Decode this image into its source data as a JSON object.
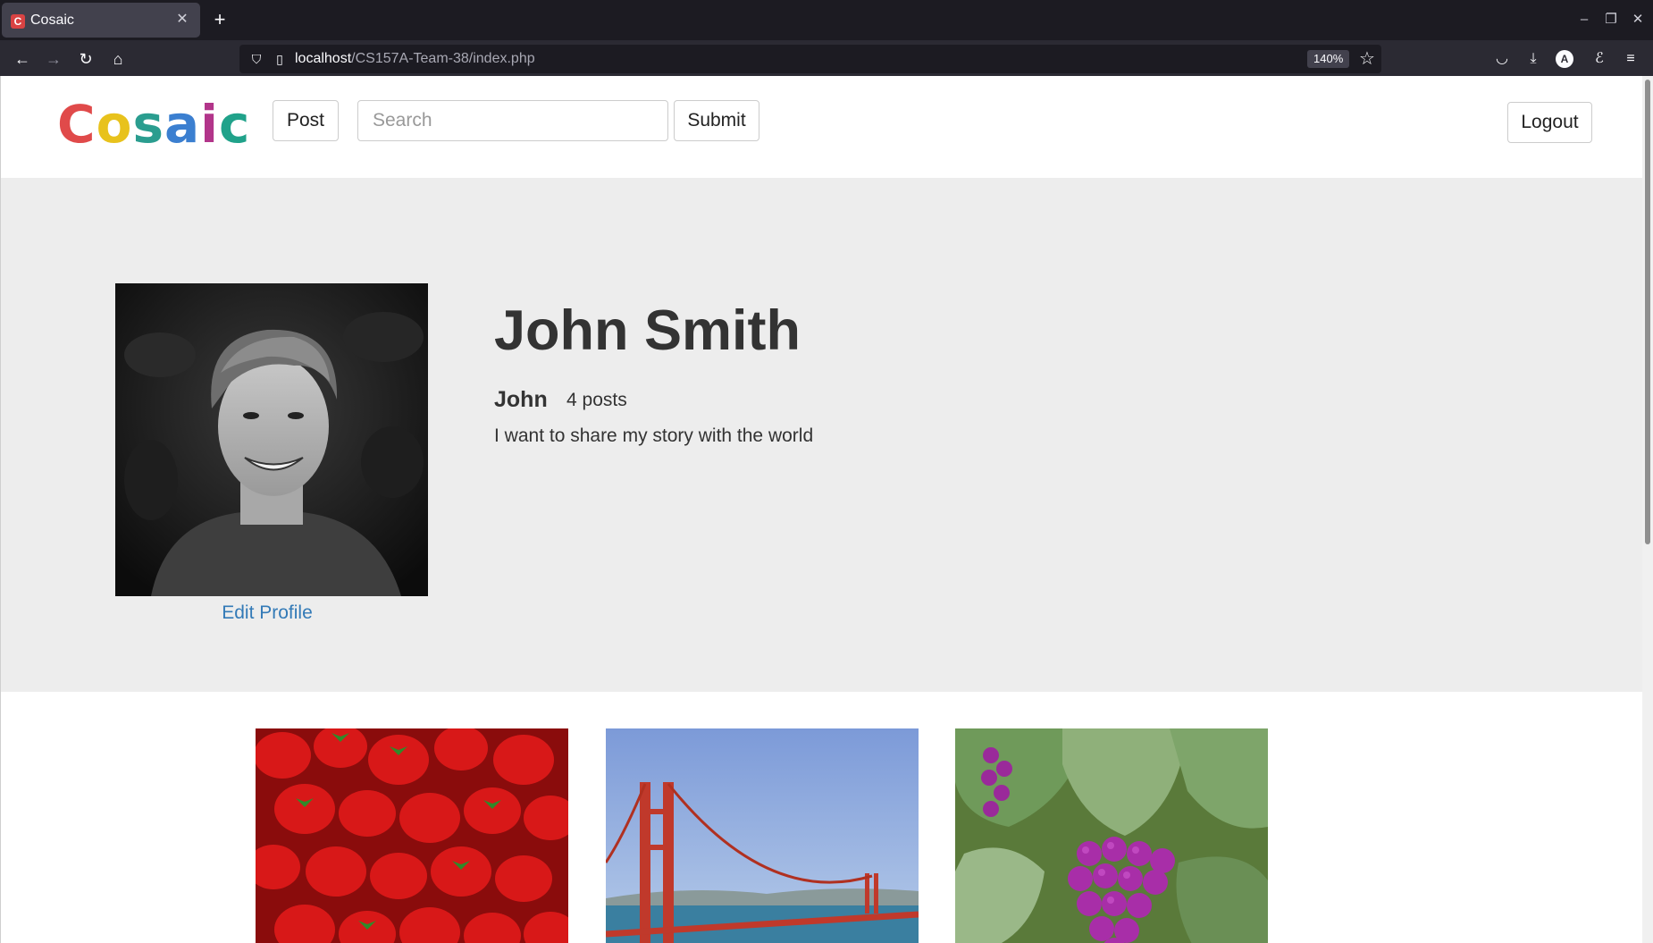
{
  "browser": {
    "tab_title": "Cosaic",
    "favicon_letter": "C",
    "url_host": "localhost",
    "url_path": "/CS157A-Team-38/index.php",
    "zoom": "140%",
    "account_initial": "A"
  },
  "header": {
    "logo_letters": [
      {
        "char": "C",
        "color": "#e04a4a"
      },
      {
        "char": "o",
        "color": "#e8c21c"
      },
      {
        "char": "s",
        "color": "#2a9d8f"
      },
      {
        "char": "a",
        "color": "#3b7fd0"
      },
      {
        "char": "i",
        "color": "#b2358a"
      },
      {
        "char": "c",
        "color": "#20a28a"
      }
    ],
    "post_label": "Post",
    "search_placeholder": "Search",
    "search_value": "",
    "submit_label": "Submit",
    "logout_label": "Logout"
  },
  "profile": {
    "full_name": "John Smith",
    "username": "John",
    "post_count": "4 posts",
    "bio": "I want to share my story with the world",
    "edit_label": "Edit Profile",
    "avatar_alt": "black and white portrait photo"
  },
  "posts": [
    {
      "subject": "strawberries"
    },
    {
      "subject": "golden-gate-bridge"
    },
    {
      "subject": "purple-grapes"
    }
  ],
  "colors": {
    "band_background": "#ededed",
    "link": "#337ab7",
    "text": "#333333"
  }
}
